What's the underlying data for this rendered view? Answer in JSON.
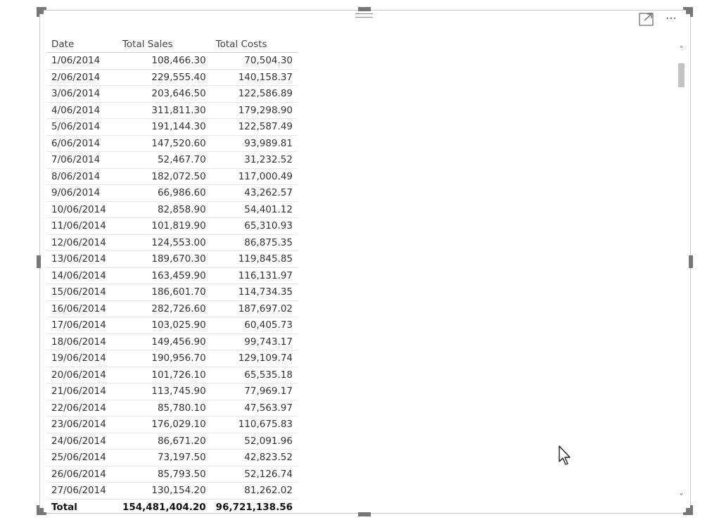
{
  "visual": {
    "focus_icon": "focus-mode-icon",
    "more_label": "⋯",
    "scroll_up_label": "˄",
    "scroll_down_label": "˅"
  },
  "table": {
    "headers": {
      "date": "Date",
      "sales": "Total Sales",
      "costs": "Total Costs"
    },
    "rows": [
      {
        "date": "1/06/2014",
        "sales": "108,466.30",
        "costs": "70,504.30"
      },
      {
        "date": "2/06/2014",
        "sales": "229,555.40",
        "costs": "140,158.37"
      },
      {
        "date": "3/06/2014",
        "sales": "203,646.50",
        "costs": "122,586.89"
      },
      {
        "date": "4/06/2014",
        "sales": "311,811.30",
        "costs": "179,298.90"
      },
      {
        "date": "5/06/2014",
        "sales": "191,144.30",
        "costs": "122,587.49"
      },
      {
        "date": "6/06/2014",
        "sales": "147,520.60",
        "costs": "93,989.81"
      },
      {
        "date": "7/06/2014",
        "sales": "52,467.70",
        "costs": "31,232.52"
      },
      {
        "date": "8/06/2014",
        "sales": "182,072.50",
        "costs": "117,000.49"
      },
      {
        "date": "9/06/2014",
        "sales": "66,986.60",
        "costs": "43,262.57"
      },
      {
        "date": "10/06/2014",
        "sales": "82,858.90",
        "costs": "54,401.12"
      },
      {
        "date": "11/06/2014",
        "sales": "101,819.90",
        "costs": "65,310.93"
      },
      {
        "date": "12/06/2014",
        "sales": "124,553.00",
        "costs": "86,875.35"
      },
      {
        "date": "13/06/2014",
        "sales": "189,670.30",
        "costs": "119,845.85"
      },
      {
        "date": "14/06/2014",
        "sales": "163,459.90",
        "costs": "116,131.97"
      },
      {
        "date": "15/06/2014",
        "sales": "186,601.70",
        "costs": "114,734.35"
      },
      {
        "date": "16/06/2014",
        "sales": "282,726.60",
        "costs": "187,697.02"
      },
      {
        "date": "17/06/2014",
        "sales": "103,025.90",
        "costs": "60,405.73"
      },
      {
        "date": "18/06/2014",
        "sales": "149,456.90",
        "costs": "99,743.17"
      },
      {
        "date": "19/06/2014",
        "sales": "190,956.70",
        "costs": "129,109.74"
      },
      {
        "date": "20/06/2014",
        "sales": "101,726.10",
        "costs": "65,535.18"
      },
      {
        "date": "21/06/2014",
        "sales": "113,745.90",
        "costs": "77,969.17"
      },
      {
        "date": "22/06/2014",
        "sales": "85,780.10",
        "costs": "47,563.97"
      },
      {
        "date": "23/06/2014",
        "sales": "176,029.10",
        "costs": "110,675.83"
      },
      {
        "date": "24/06/2014",
        "sales": "86,671.20",
        "costs": "52,091.96"
      },
      {
        "date": "25/06/2014",
        "sales": "73,197.50",
        "costs": "42,823.52"
      },
      {
        "date": "26/06/2014",
        "sales": "85,793.50",
        "costs": "52,126.74"
      },
      {
        "date": "27/06/2014",
        "sales": "130,154.20",
        "costs": "81,262.02"
      }
    ],
    "total": {
      "label": "Total",
      "sales": "154,481,404.20",
      "costs": "96,721,138.56"
    }
  }
}
